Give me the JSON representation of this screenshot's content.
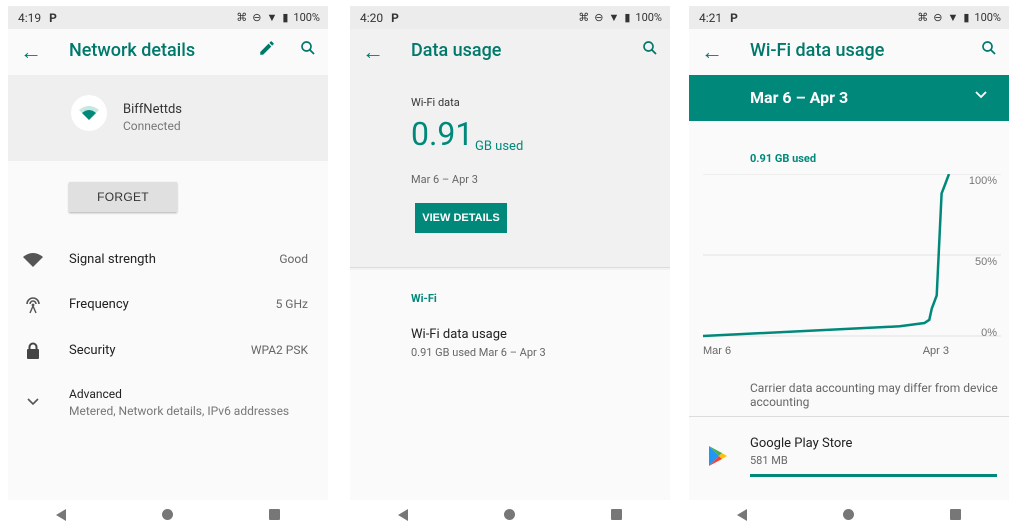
{
  "colors": {
    "accent": "#00897b",
    "accent_dark": "#00796b"
  },
  "screens": [
    {
      "status": {
        "time": "4:19",
        "battery": "100%"
      },
      "title": "Network details",
      "network": {
        "name": "BiffNettds",
        "status": "Connected"
      },
      "forget_label": "FORGET",
      "rows": [
        {
          "label": "Signal strength",
          "value": "Good",
          "icon": "wifi-icon"
        },
        {
          "label": "Frequency",
          "value": "5 GHz",
          "icon": "broadcast-icon"
        },
        {
          "label": "Security",
          "value": "WPA2 PSK",
          "icon": "lock-icon"
        }
      ],
      "advanced": {
        "label": "Advanced",
        "sub": "Metered, Network details, IPv6 addresses"
      }
    },
    {
      "status": {
        "time": "4:20",
        "battery": "100%"
      },
      "title": "Data usage",
      "card": {
        "label": "Wi-Fi data",
        "amount": "0.91",
        "unit": "GB used",
        "range": "Mar 6 – Apr 3",
        "button": "VIEW DETAILS"
      },
      "section": "Wi-Fi",
      "item": {
        "label": "Wi-Fi data usage",
        "sub": "0.91 GB used Mar 6 – Apr 3"
      }
    },
    {
      "status": {
        "time": "4:21",
        "battery": "100%"
      },
      "title": "Wi-Fi data usage",
      "cycle": "Mar 6 – Apr 3",
      "summary": "0.91 GB used",
      "disclaimer": "Carrier data accounting may differ from device accounting",
      "app": {
        "name": "Google Play Store",
        "size": "581 MB"
      }
    }
  ],
  "chart_data": {
    "type": "line",
    "x_labels": [
      "Mar 6",
      "Apr 3"
    ],
    "y_ticks": [
      "0%",
      "50%",
      "100%"
    ],
    "ylim": [
      0,
      100
    ],
    "series": [
      {
        "x": [
          0,
          0.8,
          0.9,
          0.92,
          0.93,
          0.95,
          0.97,
          0.98,
          1.0
        ],
        "y": [
          0,
          6,
          8,
          10,
          17,
          25,
          88,
          92,
          100
        ]
      }
    ]
  }
}
